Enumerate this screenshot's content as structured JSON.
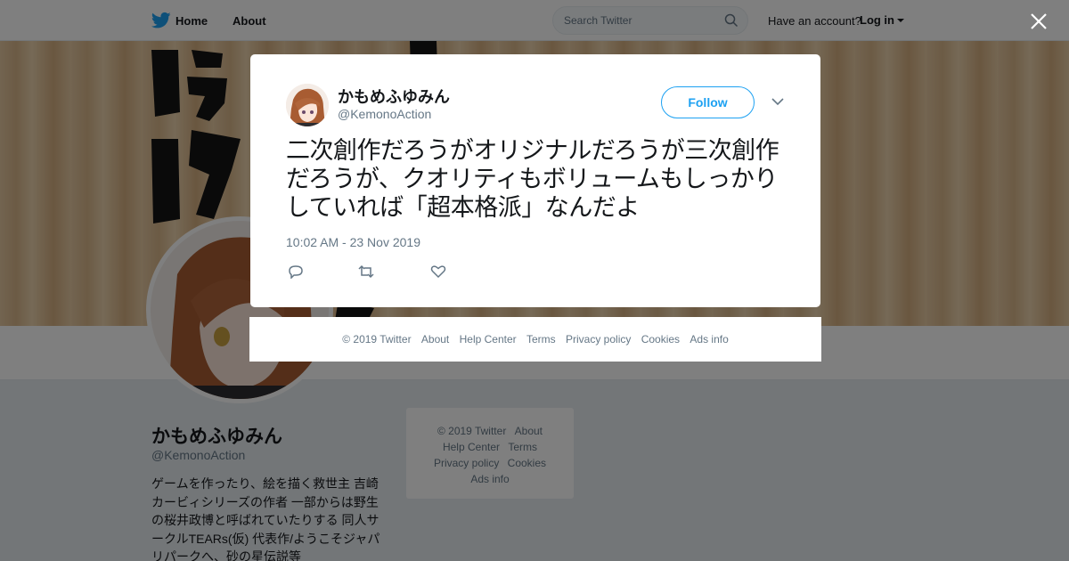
{
  "nav": {
    "home_label": "Home",
    "about_label": "About",
    "search_placeholder": "Search Twitter",
    "have_account": "Have an account?",
    "login_label": "Log in"
  },
  "profile": {
    "name": "かもめふゆみん",
    "handle": "@KemonoAction",
    "bio": "ゲームを作ったり、絵を描く救世主 吉崎カービィシリーズの作者 一部からは野生の桜井政博と呼ばれていたりする 同人サークルTEARs(仮) 代表作/ようこそジャパリパークへ、砂の星伝説等"
  },
  "side_footer": {
    "copyright": "© 2019 Twitter",
    "about": "About",
    "help": "Help Center",
    "terms": "Terms",
    "privacy": "Privacy policy",
    "cookies": "Cookies",
    "ads": "Ads info"
  },
  "tweet": {
    "name": "かもめふゆみん",
    "handle": "@KemonoAction",
    "follow_label": "Follow",
    "text": "二次創作だろうがオリジナルだろうが三次創作だろうが、クオリティもボリュームもしっかりしていれば「超本格派」なんだよ",
    "timestamp": "10:02 AM - 23 Nov 2019"
  },
  "modal_footer": {
    "copyright": "© 2019 Twitter",
    "about": "About",
    "help": "Help Center",
    "terms": "Terms",
    "privacy": "Privacy policy",
    "cookies": "Cookies",
    "ads": "Ads info"
  },
  "colors": {
    "brand": "#1da1f2",
    "text": "#14171a",
    "muted": "#657786",
    "background": "#e6ecf0"
  },
  "icons": {
    "logo": "twitter-bird-icon",
    "search": "search-icon",
    "close": "close-icon",
    "caret": "chevron-down-icon",
    "reply": "reply-icon",
    "retweet": "retweet-icon",
    "like": "heart-icon"
  }
}
